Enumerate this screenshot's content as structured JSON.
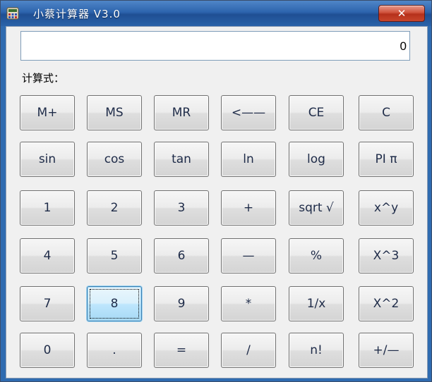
{
  "window": {
    "title": "小蔡计算器 V3.0",
    "close_label": "✕"
  },
  "display": {
    "value": "0"
  },
  "expression": {
    "label": "计算式："
  },
  "colors": {
    "titlebar": "#2d64ad",
    "close": "#c8462c",
    "button_face": "#ececec",
    "focus": "#3c7fb1"
  },
  "focused_key": "8",
  "keypad": {
    "rows": [
      [
        "M+",
        "MS",
        "MR",
        "<——",
        "CE",
        "C"
      ],
      [
        "sin",
        "cos",
        "tan",
        "ln",
        "log",
        "PI π"
      ],
      [
        "1",
        "2",
        "3",
        "+",
        "sqrt √",
        "x^y"
      ],
      [
        "4",
        "5",
        "6",
        "—",
        "%",
        "X^3"
      ],
      [
        "7",
        "8",
        "9",
        "*",
        "1/x",
        "X^2"
      ],
      [
        "0",
        ".",
        "=",
        "/",
        "n!",
        "+/—"
      ]
    ]
  }
}
